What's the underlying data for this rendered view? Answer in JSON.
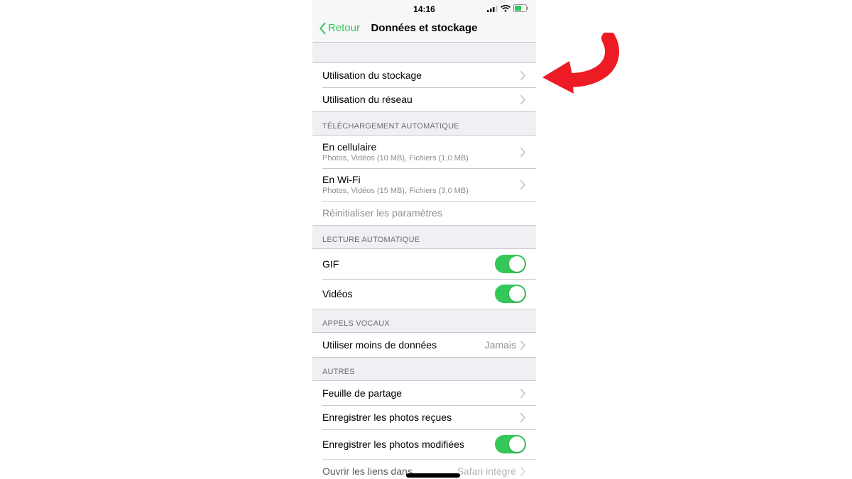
{
  "status": {
    "time": "14:16"
  },
  "nav": {
    "back": "Retour",
    "title": "Données et stockage"
  },
  "usage": {
    "storage": "Utilisation du stockage",
    "network": "Utilisation du réseau"
  },
  "autoDownload": {
    "header": "TÉLÉCHARGEMENT AUTOMATIQUE",
    "cellular": {
      "title": "En cellulaire",
      "sub": "Photos, Vidéos (10 MB), Fichiers (1,0 MB)"
    },
    "wifi": {
      "title": "En Wi-Fi",
      "sub": "Photos, Vidéos (15 MB), Fichiers (3,0 MB)"
    },
    "reset": "Réinitialiser les paramètres"
  },
  "autoPlay": {
    "header": "LECTURE AUTOMATIQUE",
    "gif": "GIF",
    "videos": "Vidéos"
  },
  "voiceCalls": {
    "header": "APPELS VOCAUX",
    "lessData": "Utiliser moins de données",
    "lessDataValue": "Jamais"
  },
  "other": {
    "header": "AUTRES",
    "shareSheet": "Feuille de partage",
    "saveReceived": "Enregistrer les photos reçues",
    "saveEdited": "Enregistrer les photos modifiées",
    "openLinks": "Ouvrir les liens dans",
    "openLinksValue": "Safari intégré"
  },
  "colors": {
    "accent": "#34c759",
    "annotation": "#ed1c24"
  }
}
